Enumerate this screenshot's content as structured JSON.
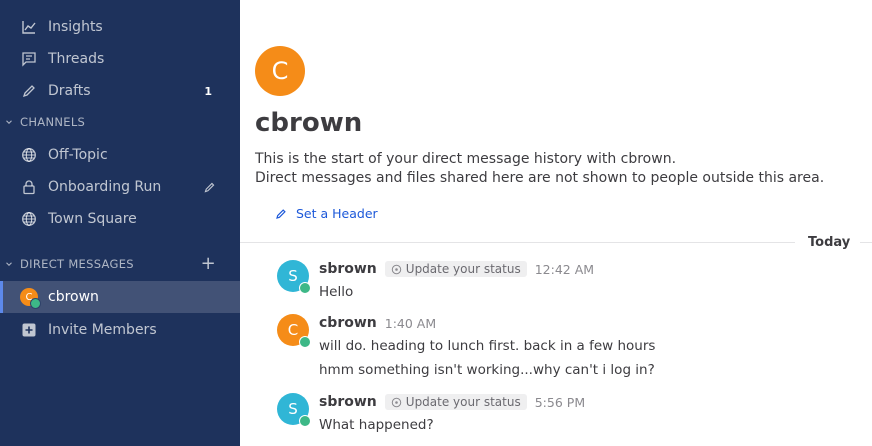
{
  "sidebar": {
    "nav": [
      {
        "label": "Insights",
        "icon": "insights-icon"
      },
      {
        "label": "Threads",
        "icon": "threads-icon"
      },
      {
        "label": "Drafts",
        "icon": "drafts-icon",
        "badge": "1"
      }
    ],
    "channels_header": "CHANNELS",
    "channels": [
      {
        "label": "Off-Topic",
        "icon": "globe-icon"
      },
      {
        "label": "Onboarding Run",
        "icon": "lock-icon"
      },
      {
        "label": "Town Square",
        "icon": "globe-icon"
      }
    ],
    "dm_header": "DIRECT MESSAGES",
    "dm": [
      {
        "label": "cbrown",
        "avatar_letter": "C"
      }
    ],
    "invite_label": "Invite Members"
  },
  "intro": {
    "avatar_letter": "C",
    "name": "cbrown",
    "line1": "This is the start of your direct message history with cbrown.",
    "line2": "Direct messages and files shared here are not shown to people outside this area.",
    "set_header": "Set a Header"
  },
  "date_separator": "Today",
  "posts": [
    {
      "avatar_letter": "S",
      "avatar_color": "#30b6d6",
      "user": "sbrown",
      "status_text": "Update your status",
      "time": "12:42 AM",
      "messages": [
        "Hello"
      ]
    },
    {
      "avatar_letter": "C",
      "avatar_color": "#f58c18",
      "user": "cbrown",
      "time": "1:40 AM",
      "messages": [
        "will do.  heading to lunch first.  back in a few hours",
        "hmm something isn't working...why can't i log in?"
      ]
    },
    {
      "avatar_letter": "S",
      "avatar_color": "#30b6d6",
      "user": "sbrown",
      "status_text": "Update your status",
      "time": "5:56 PM",
      "messages": [
        "What happened?"
      ]
    }
  ],
  "colors": {
    "sidebar_bg": "#1e325c",
    "accent": "#1c58d9",
    "online": "#3db887"
  }
}
